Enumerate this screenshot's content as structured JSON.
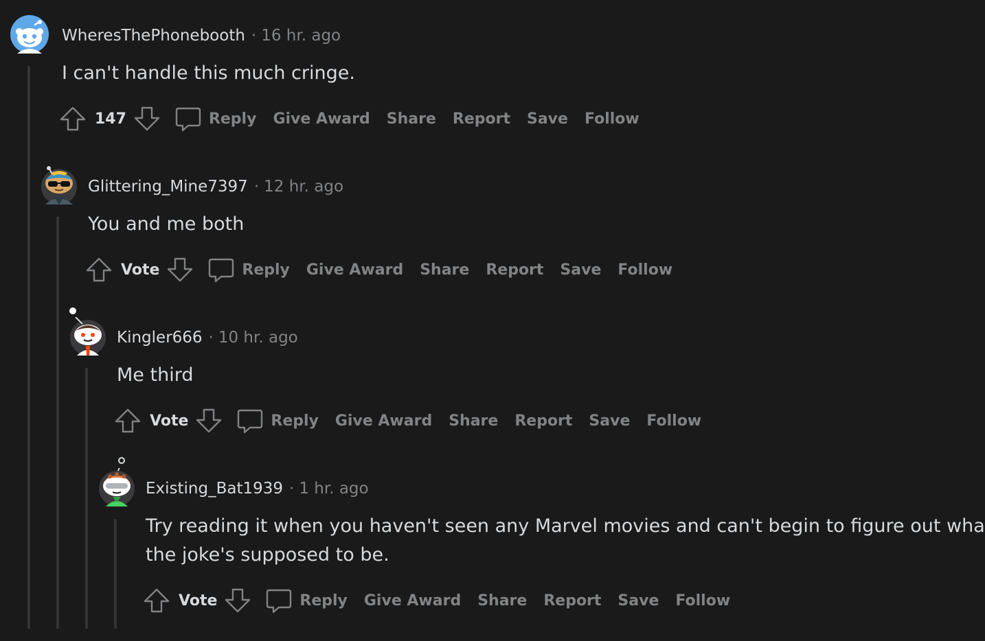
{
  "actions": {
    "reply": "Reply",
    "give_award": "Give Award",
    "share": "Share",
    "report": "Report",
    "save": "Save",
    "follow": "Follow"
  },
  "icons": {
    "upvote": "upvote-arrow-icon",
    "downvote": "downvote-arrow-icon",
    "reply": "speech-bubble-icon",
    "avatar": "snoo-avatar-icon"
  },
  "colors": {
    "background": "#1a1a1b",
    "text_primary": "#d7dadc",
    "text_secondary": "#818384",
    "thread_line": "#343536"
  },
  "comments": [
    {
      "username": "WheresThePhonebooth",
      "separator": "·",
      "time": "16 hr. ago",
      "body": "I can't handle this much cringe.",
      "votes": "147"
    },
    {
      "username": "Glittering_Mine7397",
      "separator": "·",
      "time": "12 hr. ago",
      "body": "You and me both",
      "votes": "Vote"
    },
    {
      "username": "Kingler666",
      "separator": "·",
      "time": "10 hr. ago",
      "body": "Me third",
      "votes": "Vote"
    },
    {
      "username": "Existing_Bat1939",
      "separator": "·",
      "time": "1 hr. ago",
      "body_line1": "Try reading it when you haven't seen any Marvel movies and can't begin to figure out what",
      "body_line2": "the joke's supposed to be.",
      "votes": "Vote"
    }
  ]
}
